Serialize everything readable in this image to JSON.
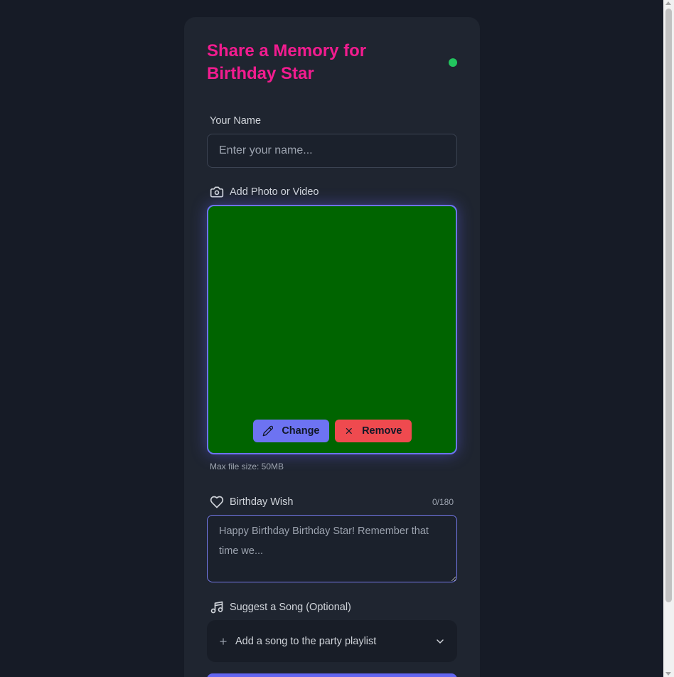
{
  "form": {
    "title": "Share a Memory for Birthday Star",
    "status_color": "#22c55e",
    "name_label": "Your Name",
    "name_placeholder": "Enter your name...",
    "name_value": "",
    "photo_label": "Add Photo or Video",
    "photo_icon": "camera-icon",
    "media_preview_color": "#006400",
    "change_label": "Change",
    "change_icon": "pencil-icon",
    "remove_label": "Remove",
    "remove_icon": "x-icon",
    "max_size_hint": "Max file size: 50MB",
    "wish_label": "Birthday Wish",
    "wish_icon": "heart-icon",
    "wish_counter": "0/180",
    "wish_placeholder": "Happy Birthday Birthday Star! Remember that time we...",
    "wish_value": "",
    "song_label": "Suggest a Song (Optional)",
    "song_icon": "music-note-icon",
    "song_prompt": "Add a song to the party playlist",
    "accent_color": "#6366f1",
    "title_color": "#f21c8f"
  }
}
